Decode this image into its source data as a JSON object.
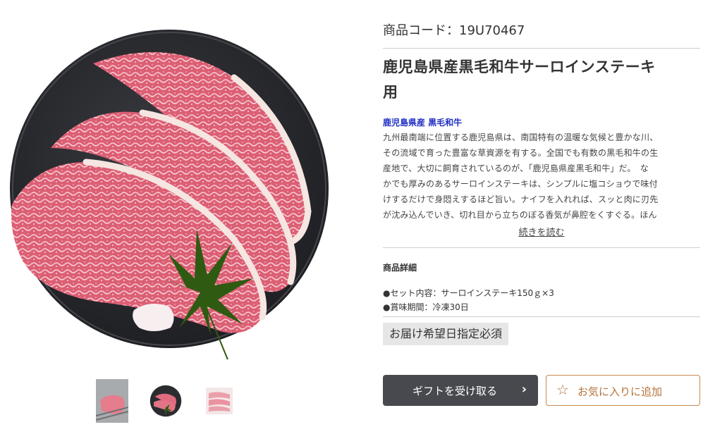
{
  "product": {
    "code_label": "商品コード：",
    "code": "19U70467",
    "title_line1": "鹿児島県産黒毛和牛サーロインステーキ",
    "title_line2": "用",
    "subtitle": "鹿児島県産 黒毛和牛",
    "description_lines": [
      "九州最南端に位置する鹿児島県は、南国特有の温暖な気候と豊かな川、",
      "その流域で育った豊富な草資源を有する。全国でも有数の黒毛和牛の生",
      "産地で、大切に飼育されているのが、「鹿児島県産黒毛和牛」だ。　な",
      "かでも厚みのあるサーロインステーキは、シンプルに塩コショウで味付",
      "けするだけで身悶えするほど旨い。ナイフを入れれば、スッと肉に刃先",
      "が沈み込んでいき、切れ目から立ちのぼる香気が鼻腔をくすぐる。ほん"
    ],
    "read_more": "続きを読む",
    "details_heading": "商品詳細",
    "details": [
      "●セット内容：サーロインステーキ150ｇ×3",
      "●賞味期間：冷凍30日"
    ],
    "badge": "お届け希望日指定必須"
  },
  "buttons": {
    "gift_label": "ギフトを受け取る",
    "gift_icon": "chevron-right-icon",
    "favorite_label": "お気に入りに追加",
    "favorite_icon": "star-outline-icon"
  },
  "gallery": {
    "thumbnails": [
      "steak-on-grill",
      "steak-on-plate",
      "sliced-beef-pack"
    ],
    "selected_index": 1
  },
  "colors": {
    "subtitle": "#1f2fc4",
    "gift_button_bg": "#48494e",
    "favorite_accent": "#b5733a",
    "badge_bg": "#e6e6e6",
    "plate": "#2b2c30",
    "meat": "#e06b7e"
  }
}
